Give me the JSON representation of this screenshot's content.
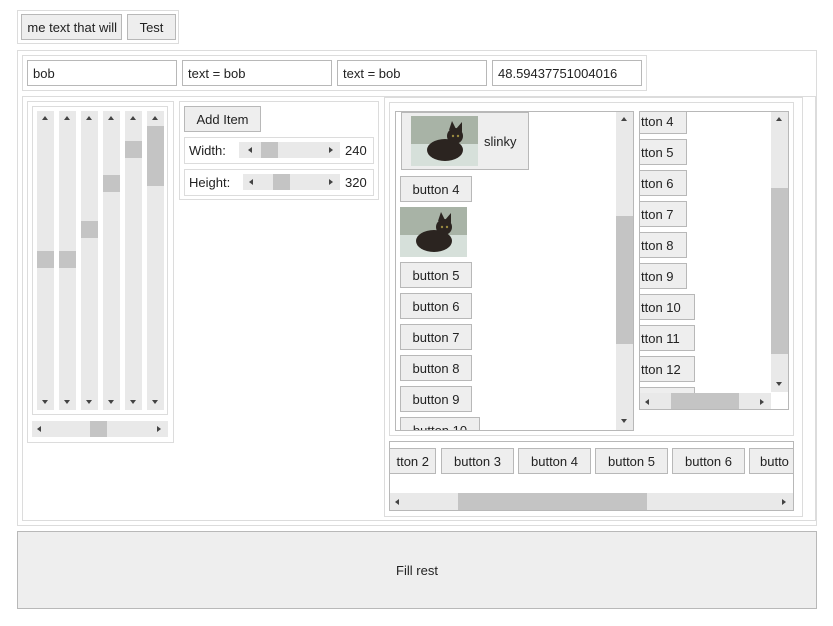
{
  "toolbar": {
    "overflow_text": "me text that will",
    "test_label": "Test"
  },
  "fields": {
    "name_value": "bob",
    "text1_value": "text = bob",
    "text2_value": "text = bob",
    "number_value": "48.59437751004016"
  },
  "controls": {
    "add_item_label": "Add Item",
    "width_label": "Width:",
    "width_value": "240",
    "height_label": "Height:",
    "height_value": "320"
  },
  "image_list": {
    "slinky_label": "slinky",
    "buttons": [
      "button 4",
      "button 5",
      "button 6",
      "button 7",
      "button 8",
      "button 9",
      "button 10"
    ]
  },
  "narrow_list": {
    "buttons": [
      "tton 4",
      "tton 5",
      "tton 6",
      "tton 7",
      "tton 8",
      "tton 9",
      "tton 10",
      "tton 11",
      "tton 12"
    ]
  },
  "horizontal_list": {
    "buttons": [
      "tton 2",
      "button 3",
      "button 4",
      "button 5",
      "button 6",
      "butto"
    ]
  },
  "fill_rest_label": "Fill rest"
}
